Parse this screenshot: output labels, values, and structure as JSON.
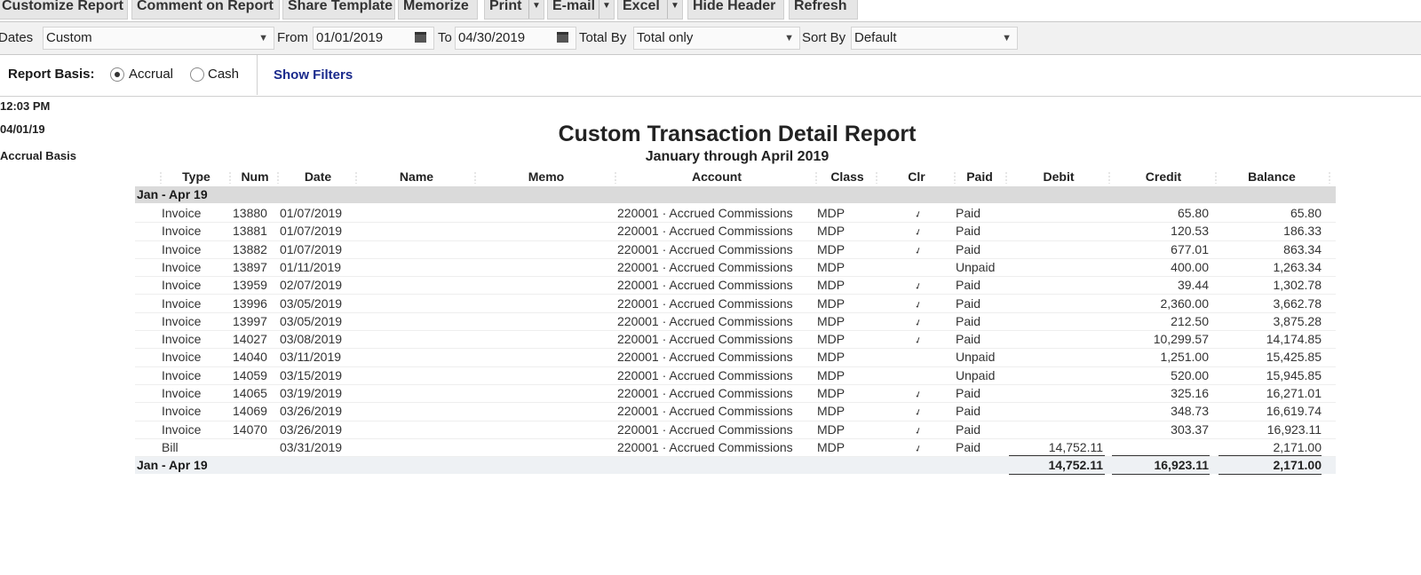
{
  "toolbar": {
    "buttons": [
      "Customize Report",
      "Comment on Report",
      "Share Template",
      "Memorize",
      "Print",
      "E-mail",
      "Excel",
      "Hide Header",
      "Refresh"
    ]
  },
  "filters": {
    "dates_label": "Dates",
    "dates_value": "Custom",
    "from_label": "From",
    "from_value": "01/01/2019",
    "to_label": "To",
    "to_value": "04/30/2019",
    "total_by_label": "Total By",
    "total_by_value": "Total only",
    "sort_by_label": "Sort By",
    "sort_by_value": "Default"
  },
  "basis": {
    "label": "Report Basis:",
    "accrual": "Accrual",
    "cash": "Cash",
    "selected": "Accrual",
    "show_filters": "Show Filters"
  },
  "header_info": {
    "time": "12:03 PM",
    "date": "04/01/19",
    "basis": "Accrual Basis"
  },
  "report": {
    "title": "Custom Transaction Detail Report",
    "subtitle": "January through April 2019",
    "columns": [
      "Type",
      "Num",
      "Date",
      "Name",
      "Memo",
      "Account",
      "Class",
      "Clr",
      "Paid",
      "Debit",
      "Credit",
      "Balance"
    ],
    "group_label": "Jan - Apr 19",
    "rows": [
      {
        "type": "Invoice",
        "num": "13880",
        "date": "01/07/2019",
        "account": "220001 · Accrued Commissions",
        "class": "MDP",
        "clr": "✓",
        "paid": "Paid",
        "debit": "",
        "credit": "65.80",
        "balance": "65.80"
      },
      {
        "type": "Invoice",
        "num": "13881",
        "date": "01/07/2019",
        "account": "220001 · Accrued Commissions",
        "class": "MDP",
        "clr": "✓",
        "paid": "Paid",
        "debit": "",
        "credit": "120.53",
        "balance": "186.33"
      },
      {
        "type": "Invoice",
        "num": "13882",
        "date": "01/07/2019",
        "account": "220001 · Accrued Commissions",
        "class": "MDP",
        "clr": "✓",
        "paid": "Paid",
        "debit": "",
        "credit": "677.01",
        "balance": "863.34"
      },
      {
        "type": "Invoice",
        "num": "13897",
        "date": "01/11/2019",
        "account": "220001 · Accrued Commissions",
        "class": "MDP",
        "clr": "",
        "paid": "Unpaid",
        "debit": "",
        "credit": "400.00",
        "balance": "1,263.34"
      },
      {
        "type": "Invoice",
        "num": "13959",
        "date": "02/07/2019",
        "account": "220001 · Accrued Commissions",
        "class": "MDP",
        "clr": "✓",
        "paid": "Paid",
        "debit": "",
        "credit": "39.44",
        "balance": "1,302.78"
      },
      {
        "type": "Invoice",
        "num": "13996",
        "date": "03/05/2019",
        "account": "220001 · Accrued Commissions",
        "class": "MDP",
        "clr": "✓",
        "paid": "Paid",
        "debit": "",
        "credit": "2,360.00",
        "balance": "3,662.78"
      },
      {
        "type": "Invoice",
        "num": "13997",
        "date": "03/05/2019",
        "account": "220001 · Accrued Commissions",
        "class": "MDP",
        "clr": "✓",
        "paid": "Paid",
        "debit": "",
        "credit": "212.50",
        "balance": "3,875.28"
      },
      {
        "type": "Invoice",
        "num": "14027",
        "date": "03/08/2019",
        "account": "220001 · Accrued Commissions",
        "class": "MDP",
        "clr": "✓",
        "paid": "Paid",
        "debit": "",
        "credit": "10,299.57",
        "balance": "14,174.85"
      },
      {
        "type": "Invoice",
        "num": "14040",
        "date": "03/11/2019",
        "account": "220001 · Accrued Commissions",
        "class": "MDP",
        "clr": "",
        "paid": "Unpaid",
        "debit": "",
        "credit": "1,251.00",
        "balance": "15,425.85"
      },
      {
        "type": "Invoice",
        "num": "14059",
        "date": "03/15/2019",
        "account": "220001 · Accrued Commissions",
        "class": "MDP",
        "clr": "",
        "paid": "Unpaid",
        "debit": "",
        "credit": "520.00",
        "balance": "15,945.85"
      },
      {
        "type": "Invoice",
        "num": "14065",
        "date": "03/19/2019",
        "account": "220001 · Accrued Commissions",
        "class": "MDP",
        "clr": "✓",
        "paid": "Paid",
        "debit": "",
        "credit": "325.16",
        "balance": "16,271.01"
      },
      {
        "type": "Invoice",
        "num": "14069",
        "date": "03/26/2019",
        "account": "220001 · Accrued Commissions",
        "class": "MDP",
        "clr": "✓",
        "paid": "Paid",
        "debit": "",
        "credit": "348.73",
        "balance": "16,619.74"
      },
      {
        "type": "Invoice",
        "num": "14070",
        "date": "03/26/2019",
        "account": "220001 · Accrued Commissions",
        "class": "MDP",
        "clr": "✓",
        "paid": "Paid",
        "debit": "",
        "credit": "303.37",
        "balance": "16,923.11"
      },
      {
        "type": "Bill",
        "num": "",
        "date": "03/31/2019",
        "account": "220001 · Accrued Commissions",
        "class": "MDP",
        "clr": "✓",
        "paid": "Paid",
        "debit": "14,752.11",
        "credit": "",
        "balance": "2,171.00"
      }
    ],
    "totals": {
      "label": "Jan - Apr 19",
      "debit": "14,752.11",
      "credit": "16,923.11",
      "balance": "2,171.00"
    }
  }
}
